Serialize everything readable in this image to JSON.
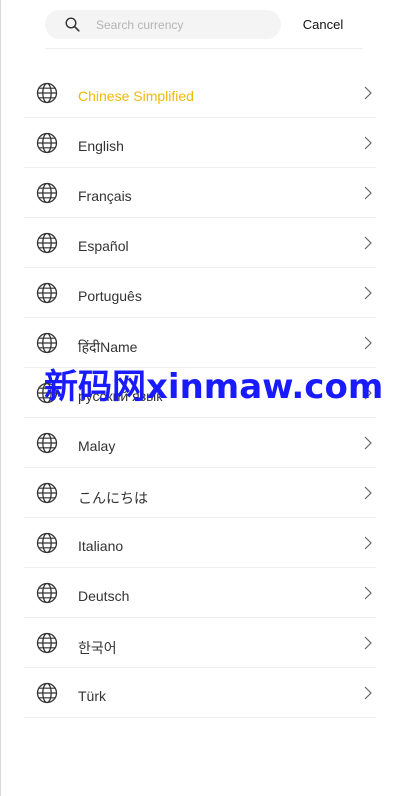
{
  "search": {
    "placeholder": "Search currency",
    "value": ""
  },
  "header": {
    "cancel_label": "Cancel"
  },
  "colors": {
    "accent": "#f0b90b",
    "text": "#333333",
    "divider": "#eeeeee",
    "watermark": "#1a1aff"
  },
  "languages": [
    {
      "label": "Chinese Simplified",
      "active": true,
      "icon": "globe-icon"
    },
    {
      "label": "English",
      "active": false,
      "icon": "globe-icon"
    },
    {
      "label": "Français",
      "active": false,
      "icon": "globe-icon"
    },
    {
      "label": "Español",
      "active": false,
      "icon": "globe-icon"
    },
    {
      "label": "Português",
      "active": false,
      "icon": "globe-icon"
    },
    {
      "label": "हिंदीName",
      "active": false,
      "icon": "globe-icon"
    },
    {
      "label": "русский язык",
      "active": false,
      "icon": "globe-icon"
    },
    {
      "label": "Malay",
      "active": false,
      "icon": "globe-icon"
    },
    {
      "label": "こんにちは",
      "active": false,
      "icon": "globe-icon"
    },
    {
      "label": "Italiano",
      "active": false,
      "icon": "globe-icon"
    },
    {
      "label": "Deutsch",
      "active": false,
      "icon": "globe-icon"
    },
    {
      "label": "한국어",
      "active": false,
      "icon": "globe-icon"
    },
    {
      "label": "Türk",
      "active": false,
      "icon": "globe-icon"
    }
  ],
  "watermark": {
    "text": "新码网xinmaw.com"
  }
}
